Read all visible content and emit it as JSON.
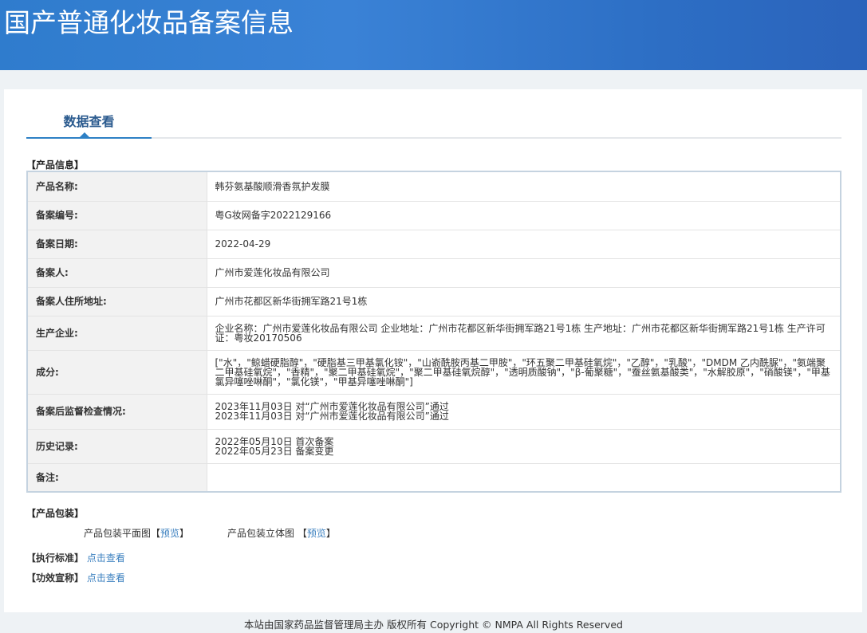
{
  "header": {
    "title": "国产普通化妆品备案信息"
  },
  "tab": {
    "label": "数据查看"
  },
  "product_info": {
    "section_title": "【产品信息】",
    "rows": [
      {
        "label": "产品名称:",
        "value": "韩芬氨基酸顺滑香氛护发膜"
      },
      {
        "label": "备案编号:",
        "value": "粤G妆网备字2022129166"
      },
      {
        "label": "备案日期:",
        "value": "2022-04-29"
      },
      {
        "label": "备案人:",
        "value": "广州市爱莲化妆品有限公司"
      },
      {
        "label": "备案人住所地址:",
        "value": "广州市花都区新华街拥军路21号1栋"
      },
      {
        "label": "生产企业:",
        "value": "企业名称：广州市爱莲化妆品有限公司 企业地址：广州市花都区新华街拥军路21号1栋 生产地址：广州市花都区新华街拥军路21号1栋 生产许可证：粤妆20170506"
      },
      {
        "label": "成分:",
        "value": "[\"水\"，\"鲸蜡硬脂醇\"，\"硬脂基三甲基氯化铵\"，\"山嵛酰胺丙基二甲胺\"，\"环五聚二甲基硅氧烷\"，\"乙醇\"，\"乳酸\"，\"DMDM 乙内酰脲\"，\"氨端聚二甲基硅氧烷\"，\"香精\"，\"聚二甲基硅氧烷\"，\"聚二甲基硅氧烷醇\"，\"透明质酸钠\"，\"β-葡聚糖\"，\"蚕丝氨基酸类\"，\"水解胶原\"，\"硝酸镁\"，\"甲基氯异噻唑啉酮\"，\"氯化镁\"，\"甲基异噻唑啉酮\"]"
      },
      {
        "label": "备案后监督检查情况:",
        "lines": [
          "2023年11月03日 对“广州市爱莲化妆品有限公司”通过",
          "2023年11月03日 对“广州市爱莲化妆品有限公司”通过"
        ]
      },
      {
        "label": "历史记录:",
        "lines": [
          "2022年05月10日 首次备案",
          "2022年05月23日 备案变更"
        ]
      },
      {
        "label": "备注:",
        "value": ""
      }
    ]
  },
  "packaging": {
    "section_title": "【产品包装】",
    "flat_label": "产品包装平面图",
    "solid_label": "产品包装立体图",
    "preview": "预览",
    "bracket_open": "【",
    "bracket_close": "】"
  },
  "standard": {
    "label": "【执行标准】",
    "link": "点击查看"
  },
  "efficacy": {
    "label": "【功效宣称】",
    "link": "点击查看"
  },
  "footer": {
    "text": "本站由国家药品监督管理局主办 版权所有 Copyright © NMPA All Rights Reserved"
  }
}
